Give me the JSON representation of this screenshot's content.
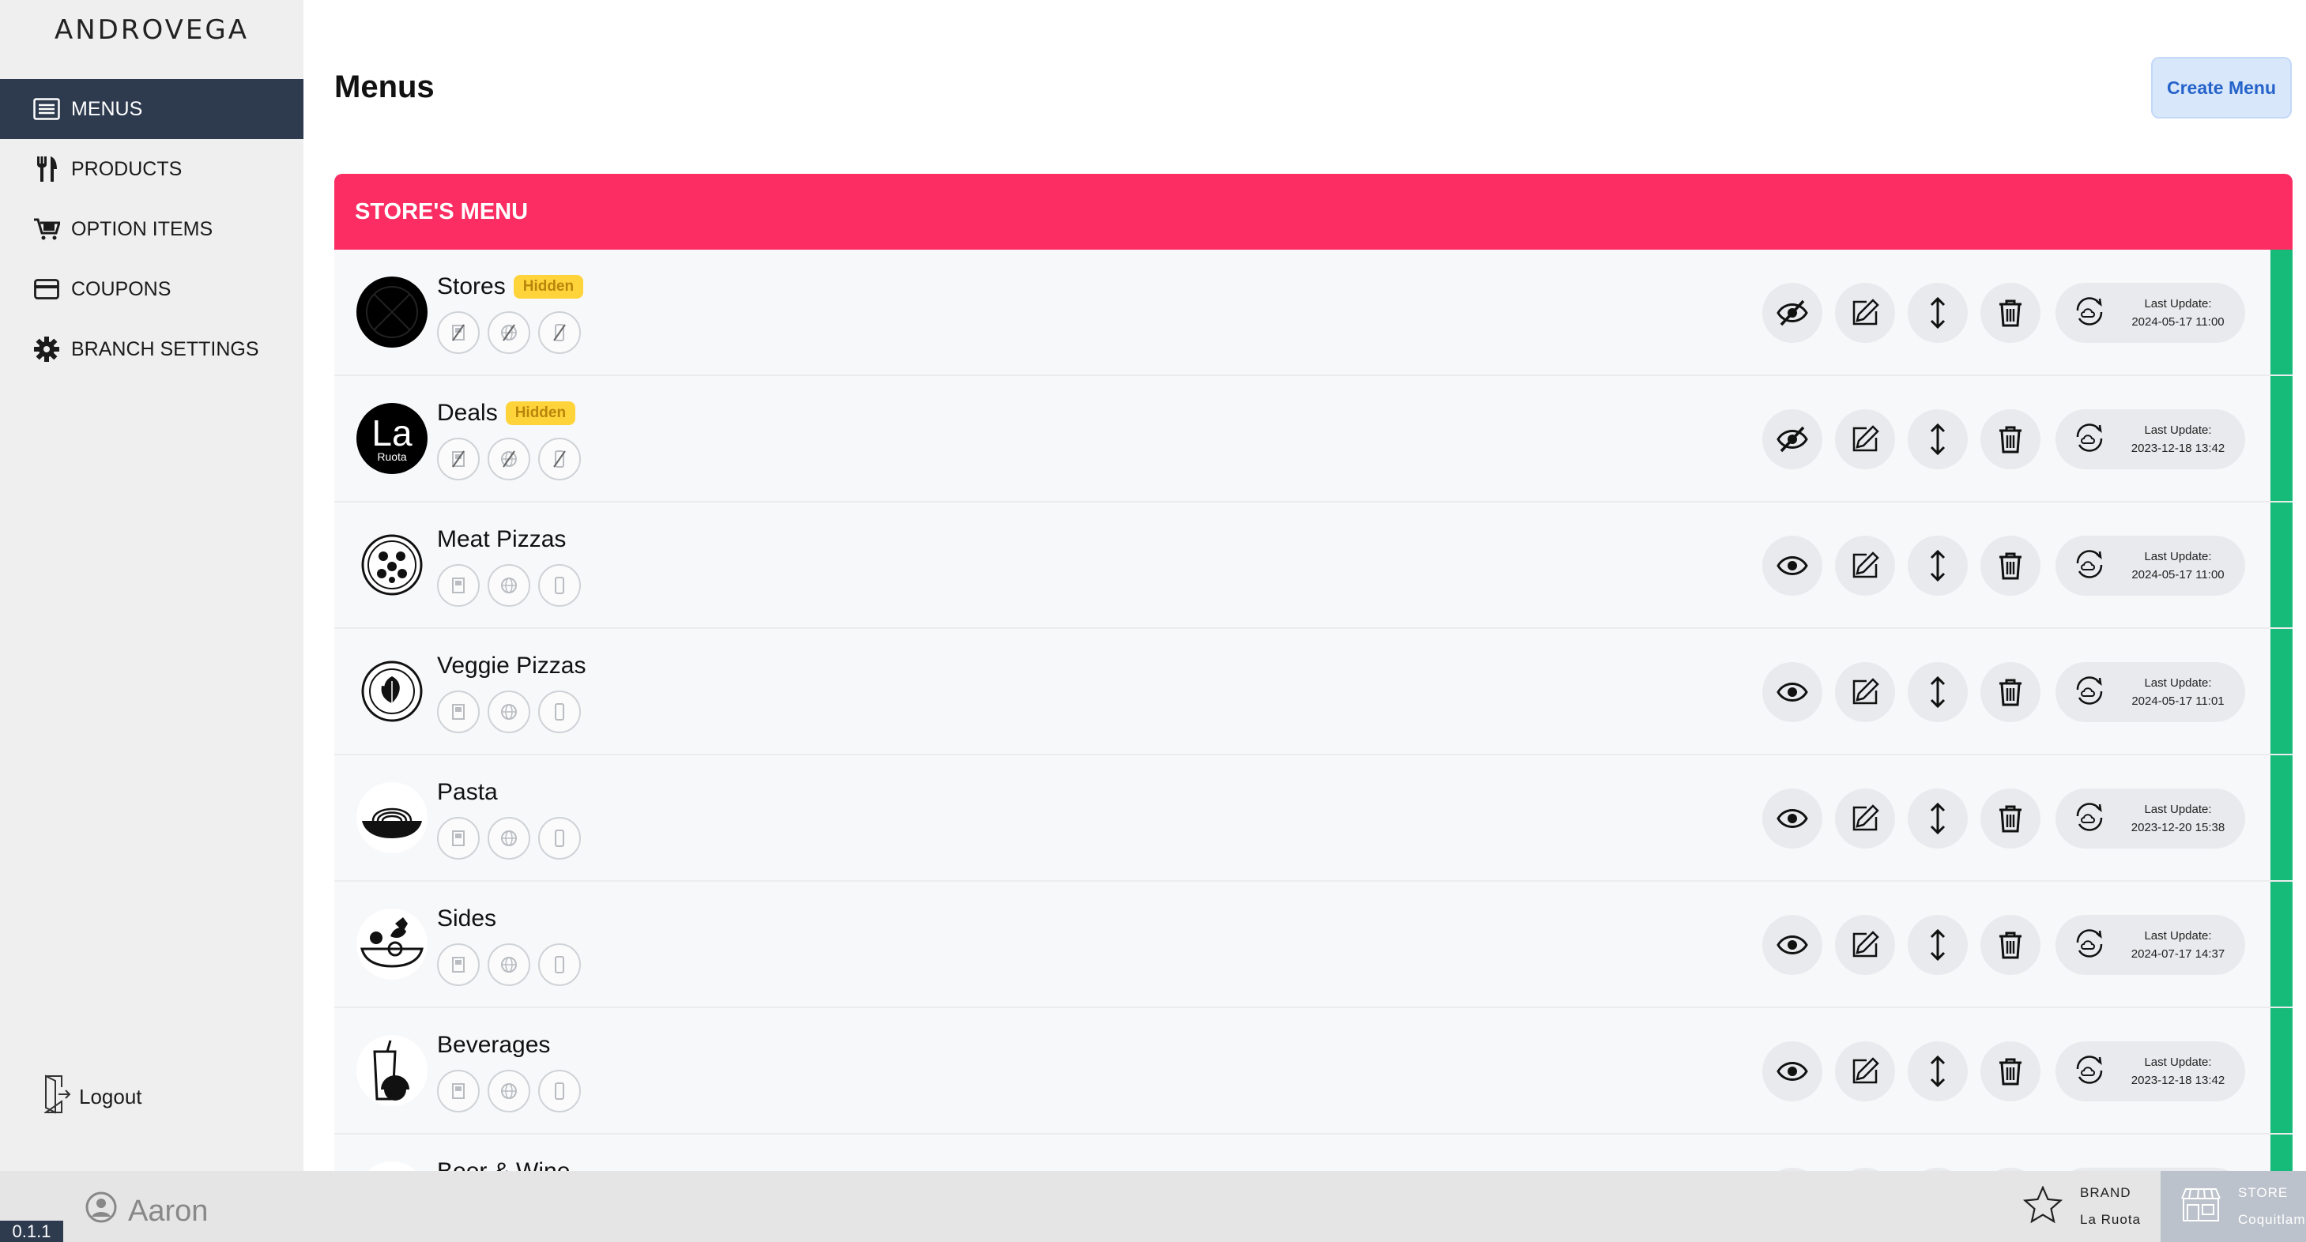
{
  "app": {
    "logo_text": "ANDROVEGA",
    "version": "0.1.1"
  },
  "sidebar": {
    "items": [
      {
        "label": "MENUS",
        "icon": "list-icon",
        "active": true
      },
      {
        "label": "PRODUCTS",
        "icon": "utensils-icon",
        "active": false
      },
      {
        "label": "OPTION ITEMS",
        "icon": "cart-icon",
        "active": false
      },
      {
        "label": "COUPONS",
        "icon": "card-icon",
        "active": false
      },
      {
        "label": "BRANCH SETTINGS",
        "icon": "gear-icon",
        "active": false
      }
    ],
    "logout_label": "Logout"
  },
  "header": {
    "title": "Menus",
    "create_label": "Create Menu"
  },
  "panel": {
    "title": "STORE'S MENU"
  },
  "menus": [
    {
      "name": "Stores",
      "badge": "Hidden",
      "visible": false,
      "update_label": "Last Update:",
      "update_time": "2024-05-17 11:00",
      "thumb": "pizza-slices-icon"
    },
    {
      "name": "Deals",
      "badge": "Hidden",
      "visible": false,
      "update_label": "Last Update:",
      "update_time": "2023-12-18 13:42",
      "thumb": "la-ruota-logo",
      "thumb_text": "La",
      "thumb_sub": "Ruota"
    },
    {
      "name": "Meat Pizzas",
      "badge": "",
      "visible": true,
      "update_label": "Last Update:",
      "update_time": "2024-05-17 11:00",
      "thumb": "meat-pizza-icon"
    },
    {
      "name": "Veggie Pizzas",
      "badge": "",
      "visible": true,
      "update_label": "Last Update:",
      "update_time": "2024-05-17 11:01",
      "thumb": "leaf-pizza-icon"
    },
    {
      "name": "Pasta",
      "badge": "",
      "visible": true,
      "update_label": "Last Update:",
      "update_time": "2023-12-20 15:38",
      "thumb": "pasta-bowl-icon"
    },
    {
      "name": "Sides",
      "badge": "",
      "visible": true,
      "update_label": "Last Update:",
      "update_time": "2024-07-17 14:37",
      "thumb": "salad-bowl-icon"
    },
    {
      "name": "Beverages",
      "badge": "",
      "visible": true,
      "update_label": "Last Update:",
      "update_time": "2023-12-18 13:42",
      "thumb": "drink-cup-icon"
    },
    {
      "name": "Beer & Wine",
      "badge": "",
      "visible": true,
      "update_label": "",
      "update_time": "",
      "thumb": "beer-icon"
    }
  ],
  "footer": {
    "user_name": "Aaron",
    "brand_label": "BRAND",
    "brand_value": "La Ruota",
    "store_label": "STORE",
    "store_value": "Coquitlam"
  },
  "colors": {
    "sidebar_active": "#2e3b4f",
    "panel_header": "#fb2d62",
    "accent_green": "#16bb7a",
    "badge_yellow": "#ffd43b",
    "create_button_bg": "#d9e7fb"
  }
}
